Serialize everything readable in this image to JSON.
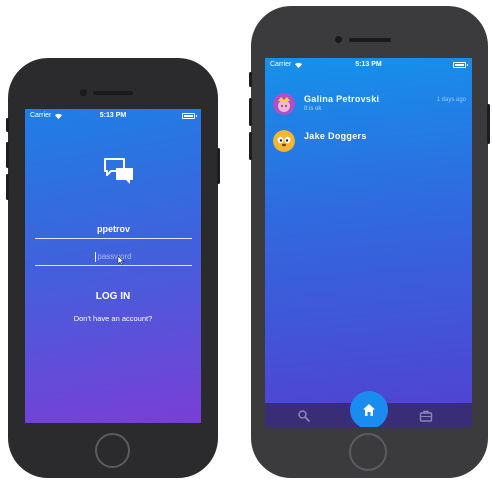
{
  "login_screen": {
    "status": {
      "carrier": "Carrier",
      "time": "5:13 PM"
    },
    "icon": "chat-bubbles-icon",
    "username_value": "ppetrov",
    "password_placeholder": "password",
    "login_label": "LOG IN",
    "signup_prompt": "Don't have an account?"
  },
  "conversations_screen": {
    "status": {
      "carrier": "Carrier",
      "time": "5:13 PM"
    },
    "conversations": [
      {
        "name": "Galina Petrovski",
        "preview": "It is ok",
        "time": "1 days ago",
        "avatar": "princess-avatar"
      },
      {
        "name": "Jake Doggers",
        "preview": "",
        "time": "",
        "avatar": "dog-avatar"
      }
    ],
    "tabs": [
      {
        "icon": "search-icon"
      },
      {
        "icon": "home-icon",
        "active": true
      },
      {
        "icon": "briefcase-icon"
      }
    ],
    "colors": {
      "tab_bar": "#3a2d78",
      "fab": "#1a8cf0"
    }
  }
}
